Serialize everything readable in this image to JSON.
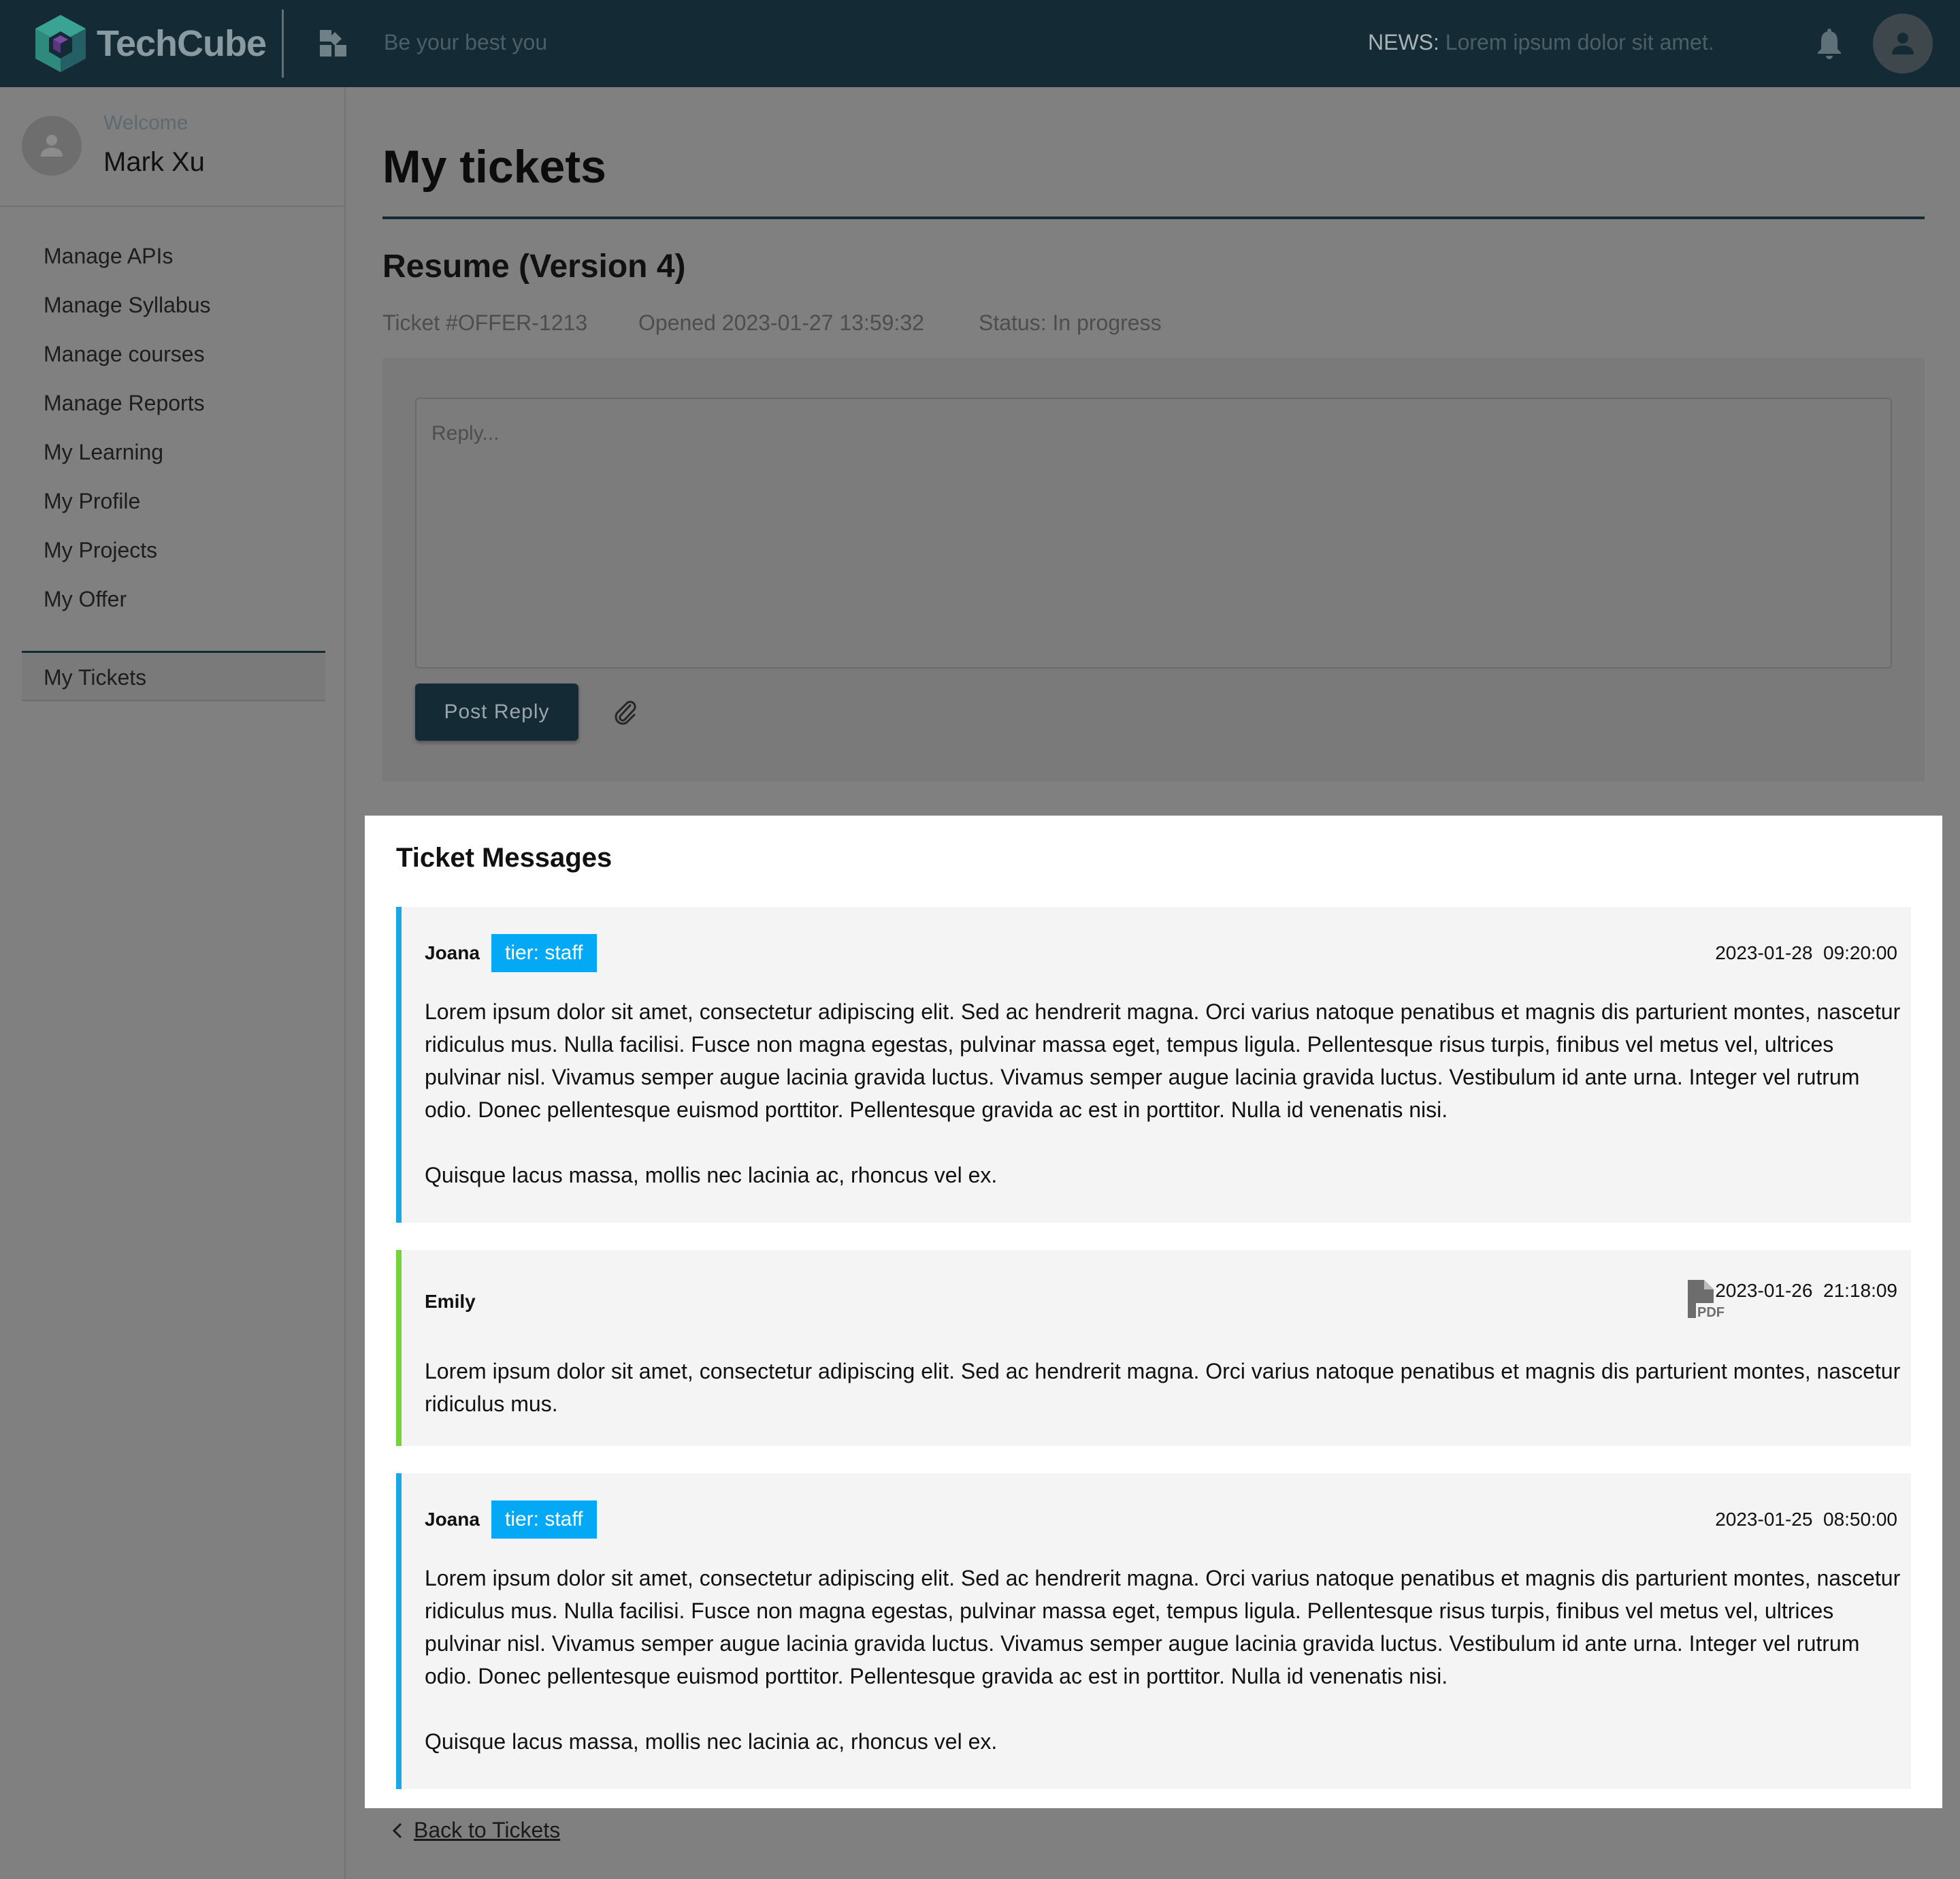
{
  "header": {
    "brand": "TechCube",
    "tagline": "Be your best you",
    "news_label": "NEWS:",
    "news_text": "Lorem ipsum dolor sit amet."
  },
  "sidebar": {
    "welcome_label": "Welcome",
    "user_name": "Mark Xu",
    "items": [
      {
        "label": "Manage APIs"
      },
      {
        "label": "Manage Syllabus"
      },
      {
        "label": "Manage courses"
      },
      {
        "label": "Manage Reports"
      },
      {
        "label": "My Learning"
      },
      {
        "label": "My Profile"
      },
      {
        "label": "My Projects"
      },
      {
        "label": "My Offer"
      }
    ],
    "active_item": "My Tickets"
  },
  "main": {
    "page_title": "My tickets",
    "ticket": {
      "title": "Resume (Version 4)",
      "number": "Ticket #OFFER-1213",
      "opened": "Opened 2023-01-27 13:59:32",
      "status": "Status: In progress"
    },
    "reply": {
      "placeholder": "Reply...",
      "post_label": "Post Reply"
    },
    "messages_title": "Ticket Messages",
    "messages": [
      {
        "author": "Joana",
        "tier": "tier: staff",
        "date": "2023-01-28  09:20:00",
        "body": [
          "Lorem ipsum dolor sit amet, consectetur adipiscing elit. Sed ac hendrerit magna. Orci varius natoque penatibus et magnis dis parturient montes, nascetur ridiculus mus. Nulla facilisi. Fusce non magna egestas, pulvinar massa eget, tempus ligula. Pellentesque risus turpis, finibus vel metus vel, ultrices pulvinar nisl. Vivamus semper augue lacinia gravida luctus. Vivamus semper augue lacinia gravida luctus. Vestibulum id ante urna. Integer vel rutrum odio. Donec pellentesque euismod porttitor. Pellentesque gravida ac est in porttitor. Nulla id venenatis nisi.",
          "Quisque lacus massa, mollis nec lacinia ac, rhoncus vel ex."
        ]
      },
      {
        "author": "Emily",
        "attachment_icon": "pdf-icon",
        "date": "2023-01-26  21:18:09",
        "body": [
          "Lorem ipsum dolor sit amet, consectetur adipiscing elit. Sed ac hendrerit magna. Orci varius natoque penatibus et magnis dis parturient montes, nascetur ridiculus mus."
        ]
      },
      {
        "author": "Joana",
        "tier": "tier: staff",
        "date": "2023-01-25  08:50:00",
        "body": [
          "Lorem ipsum dolor sit amet, consectetur adipiscing elit. Sed ac hendrerit magna. Orci varius natoque penatibus et magnis dis parturient montes, nascetur ridiculus mus. Nulla facilisi. Fusce non magna egestas, pulvinar massa eget, tempus ligula. Pellentesque risus turpis, finibus vel metus vel, ultrices pulvinar nisl. Vivamus semper augue lacinia gravida luctus. Vivamus semper augue lacinia gravida luctus. Vestibulum id ante urna. Integer vel rutrum odio. Donec pellentesque euismod porttitor. Pellentesque gravida ac est in porttitor. Nulla id venenatis nisi.",
          "Quisque lacus massa, mollis nec lacinia ac, rhoncus vel ex."
        ]
      }
    ],
    "back_label": "Back to Tickets"
  },
  "colors": {
    "brand_dark": "#142b35",
    "staff_accent": "#1ba7e8",
    "tier_badge": "#03a9f4",
    "user_accent": "#72d33a"
  }
}
